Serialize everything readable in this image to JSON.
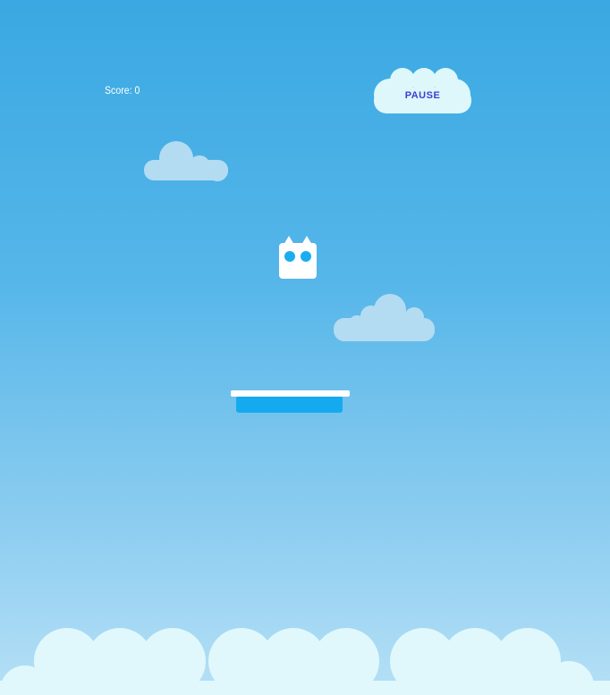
{
  "hud": {
    "score_label": "Score:",
    "score_value": "0",
    "pause_label": "PAUSE"
  },
  "colors": {
    "sky_top": "#3aa8e2",
    "sky_bottom": "#b6e0f6",
    "pause_cloud": "#ddf7fb",
    "pause_text": "#3b3fcf",
    "bg_cloud": "#b3dcf2",
    "player_body": "#ffffff",
    "player_eyes": "#1aaef0",
    "platform_top": "#ffffff",
    "platform_body": "#15aaf0",
    "ground_cloud": "#e0f8fc"
  },
  "icons": {
    "player": "white-cat-block-icon",
    "pause": "cloud-icon"
  }
}
